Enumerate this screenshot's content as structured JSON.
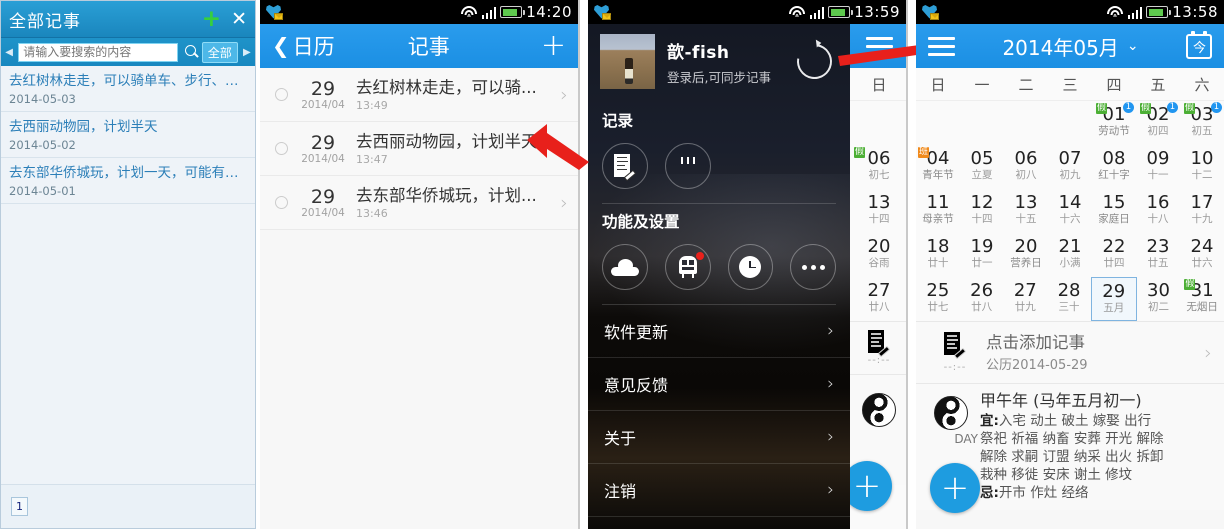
{
  "panel1": {
    "name": "desktop-memo-window",
    "title": "全部记事",
    "add_label": "+",
    "close_label": "✕",
    "search": {
      "placeholder": "请输入要搜索的内容",
      "value": "",
      "filter_label": "全部"
    },
    "prev_arrow": "◀",
    "next_arrow": "▶",
    "items": [
      {
        "title": "去红树林走走，可以骑单车、步行、…",
        "date": "2014-05-03"
      },
      {
        "title": "去西丽动物园，计划半天",
        "date": "2014-05-02"
      },
      {
        "title": "去东部华侨城玩，计划一天，可能有…",
        "date": "2014-05-01"
      }
    ],
    "page_number": "1"
  },
  "panel2": {
    "name": "memo-list-screen",
    "status": {
      "clock": "14:20"
    },
    "actionbar": {
      "back_label": "日历",
      "title": "记事",
      "add_label": "+"
    },
    "rows": [
      {
        "day": "29",
        "ym": "2014/04",
        "memo": "去红树林走走，可以骑...",
        "time": "13:49",
        "chev": "›"
      },
      {
        "day": "29",
        "ym": "2014/04",
        "memo": "去西丽动物园，计划半天",
        "time": "13:47",
        "chev": "›"
      },
      {
        "day": "29",
        "ym": "2014/04",
        "memo": "去东部华侨城玩，计划...",
        "time": "13:46",
        "chev": "›"
      }
    ]
  },
  "panel3": {
    "name": "navigation-drawer-screen",
    "status": {
      "clock": "13:59"
    },
    "profile": {
      "name": "歆-fish",
      "subtitle": "登录后,可同步记事"
    },
    "section_record": {
      "title": "记录"
    },
    "record_icons": [
      {
        "name": "memo-icon",
        "label": ""
      },
      {
        "name": "birthday-cake-icon",
        "label": ""
      }
    ],
    "section_settings": {
      "title": "功能及设置"
    },
    "setting_icons": [
      {
        "name": "cloud-icon"
      },
      {
        "name": "train-icon",
        "badge": true
      },
      {
        "name": "clock-icon"
      },
      {
        "name": "more-icon"
      }
    ],
    "menu": [
      {
        "label": "软件更新",
        "chev": "›"
      },
      {
        "label": "意见反馈",
        "chev": "›"
      },
      {
        "label": "关于",
        "chev": "›"
      },
      {
        "label": "注销",
        "chev": "›"
      }
    ],
    "peek_calendar": {
      "weekhead": "日",
      "days": [
        {
          "d": "06",
          "l": "初七",
          "hol": "假"
        },
        {
          "d": "13",
          "l": "十四"
        },
        {
          "d": "20",
          "l": "谷雨"
        },
        {
          "d": "27",
          "l": "廿八"
        }
      ],
      "memo_time": "--:--",
      "fab_label": "+"
    }
  },
  "panel4": {
    "name": "calendar-month-screen",
    "status": {
      "clock": "13:58"
    },
    "actionbar": {
      "title": "2014年05月",
      "chev": "⌄",
      "today_label": "今",
      "menu_name": "hamburger-icon"
    },
    "weekdays": [
      "日",
      "一",
      "二",
      "三",
      "四",
      "五",
      "六"
    ],
    "weeks": [
      [
        {
          "d": "",
          "l": ""
        },
        {
          "d": "",
          "l": ""
        },
        {
          "d": "",
          "l": ""
        },
        {
          "d": "",
          "l": ""
        },
        {
          "d": "01",
          "l": "劳动节",
          "hol": "假",
          "evt": "1"
        },
        {
          "d": "02",
          "l": "初四",
          "hol": "假",
          "evt": "1"
        },
        {
          "d": "03",
          "l": "初五",
          "hol": "假",
          "evt": "1"
        }
      ],
      [
        {
          "d": "04",
          "l": "青年节",
          "work": "班"
        },
        {
          "d": "05",
          "l": "立夏"
        },
        {
          "d": "06",
          "l": "初八"
        },
        {
          "d": "07",
          "l": "初九"
        },
        {
          "d": "08",
          "l": "红十字"
        },
        {
          "d": "09",
          "l": "十一"
        },
        {
          "d": "10",
          "l": "十二"
        }
      ],
      [
        {
          "d": "11",
          "l": "母亲节"
        },
        {
          "d": "12",
          "l": "十四"
        },
        {
          "d": "13",
          "l": "十五"
        },
        {
          "d": "14",
          "l": "十六"
        },
        {
          "d": "15",
          "l": "家庭日"
        },
        {
          "d": "16",
          "l": "十八"
        },
        {
          "d": "17",
          "l": "十九"
        }
      ],
      [
        {
          "d": "18",
          "l": "廿十"
        },
        {
          "d": "19",
          "l": "廿一"
        },
        {
          "d": "20",
          "l": "营养日"
        },
        {
          "d": "21",
          "l": "小满"
        },
        {
          "d": "22",
          "l": "廿四"
        },
        {
          "d": "23",
          "l": "廿五"
        },
        {
          "d": "24",
          "l": "廿六"
        }
      ],
      [
        {
          "d": "25",
          "l": "廿七"
        },
        {
          "d": "26",
          "l": "廿八"
        },
        {
          "d": "27",
          "l": "廿九"
        },
        {
          "d": "28",
          "l": "三十"
        },
        {
          "d": "29",
          "l": "五月",
          "sel": true
        },
        {
          "d": "30",
          "l": "初二"
        },
        {
          "d": "31",
          "l": "无烟日",
          "hol": "假"
        }
      ]
    ],
    "memo_row": {
      "time": "--:--",
      "title": "点击添加记事",
      "sub": "公历2014-05-29",
      "chev": "›"
    },
    "almanac": {
      "title": "甲午年 (马年五月初一)",
      "good_label": "宜:",
      "good": "入宅 动土 破土 嫁娶 出行",
      "good2": "祭祀 祈福 纳畜 安葬 开光 解除",
      "good3": "解除 求嗣 订盟 纳采 出火 拆卸",
      "good4": "栽种 移徙 安床 谢土 修坟",
      "bad_label": "忌:",
      "bad": "开市 作灶 经络",
      "day_badge": "DAY"
    },
    "fab_label": "+"
  },
  "colors": {
    "accent_blue": "#2196f0",
    "desktop_blue": "#2196ce",
    "holiday_green": "#4caf35",
    "workday_orange": "#f08a1c",
    "arrow_red": "#e8201b",
    "link_blue": "#2c7fb8",
    "plus_green": "#36d03c"
  }
}
